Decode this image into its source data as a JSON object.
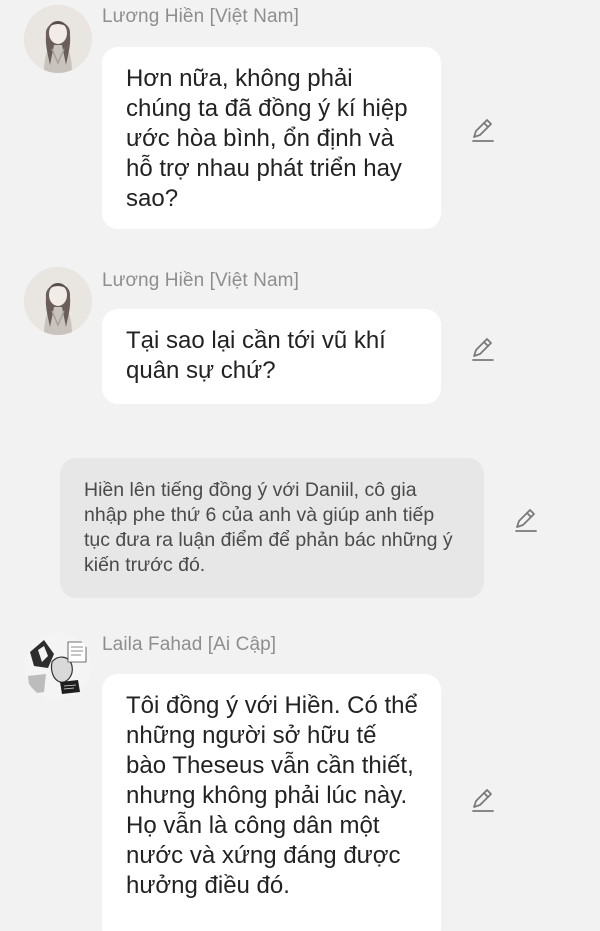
{
  "messages": [
    {
      "sender": "Lương Hiền [Việt Nam]",
      "text": "Hơn nữa, không phải chúng ta đã đồng ý kí hiệp ước hòa bình, ổn định và hỗ trợ nhau phát triển hay sao?"
    },
    {
      "sender": "Lương Hiền [Việt Nam]",
      "text": "Tại sao lại cần tới vũ khí quân sự chứ?"
    },
    {
      "narration": "Hiền lên tiếng đồng ý với Daniil, cô gia nhập phe thứ 6 của anh và giúp anh tiếp tục đưa ra luận điểm để phản bác những ý kiến trước đó."
    },
    {
      "sender": "Laila Fahad [Ai Cập]",
      "text": "Tôi đồng ý với Hiền. Có thể những người sở hữu tế bào Theseus vẫn cần thiết, nhưng không phải lúc này. Họ vẫn là công dân một nước và xứng đáng được hưởng điều đó."
    }
  ],
  "icons": {
    "avatar_1": "avatar-illustration-icon",
    "avatar_2": "avatar-illustration-icon",
    "avatar_3": "avatar-manga-icon",
    "edit": "pencil-edit-icon"
  },
  "colors": {
    "background": "#f2f2f2",
    "bubble": "#ffffff",
    "narration_bubble": "#e7e7e7",
    "sender_text": "#8e8e8e",
    "icon": "#7a7a7a"
  }
}
